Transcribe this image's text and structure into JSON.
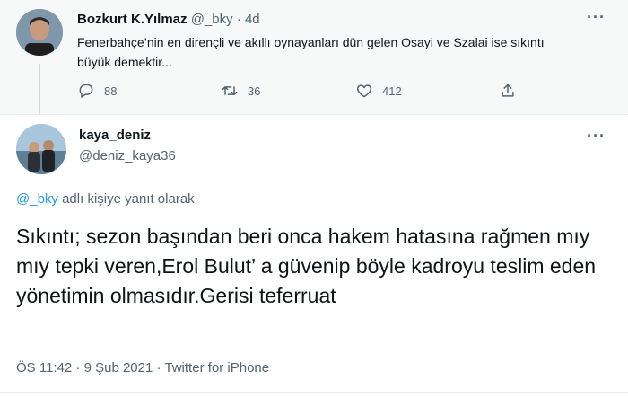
{
  "quoted_tweet": {
    "author_name": "Bozkurt K.Yılmaz",
    "author_handle": "@_bky",
    "separator": "·",
    "age": "4d",
    "text": "Fenerbahçe’nin en dirençli ve akıllı oynayanları dün gelen Osayi ve Szalai ise sıkıntı büyük demektir...",
    "replies": "88",
    "retweets": "36",
    "likes": "412"
  },
  "main_tweet": {
    "author_name": "kaya_deniz",
    "author_handle": "@deniz_kaya36",
    "reply_mention": "@_bky",
    "reply_suffix": "adlı kişiye yanıt olarak",
    "text": "Sıkıntı; sezon başından beri onca hakem hatasına rağmen mıy mıy tepki veren,Erol Bulut’ a güvenip böyle kadroyu teslim eden yönetimin olmasıdır.Gerisi teferruat",
    "timestamp": "ÖS 11:42 · 9 Şub 2021 · Twitter for iPhone"
  },
  "more_glyph": "···",
  "colors": {
    "link": "#1d9bf0",
    "muted": "#536471",
    "text": "#0f1419",
    "top_bg": "#f7f9f9"
  },
  "icons": [
    "reply-icon",
    "retweet-icon",
    "like-icon",
    "share-icon",
    "more-icon"
  ]
}
